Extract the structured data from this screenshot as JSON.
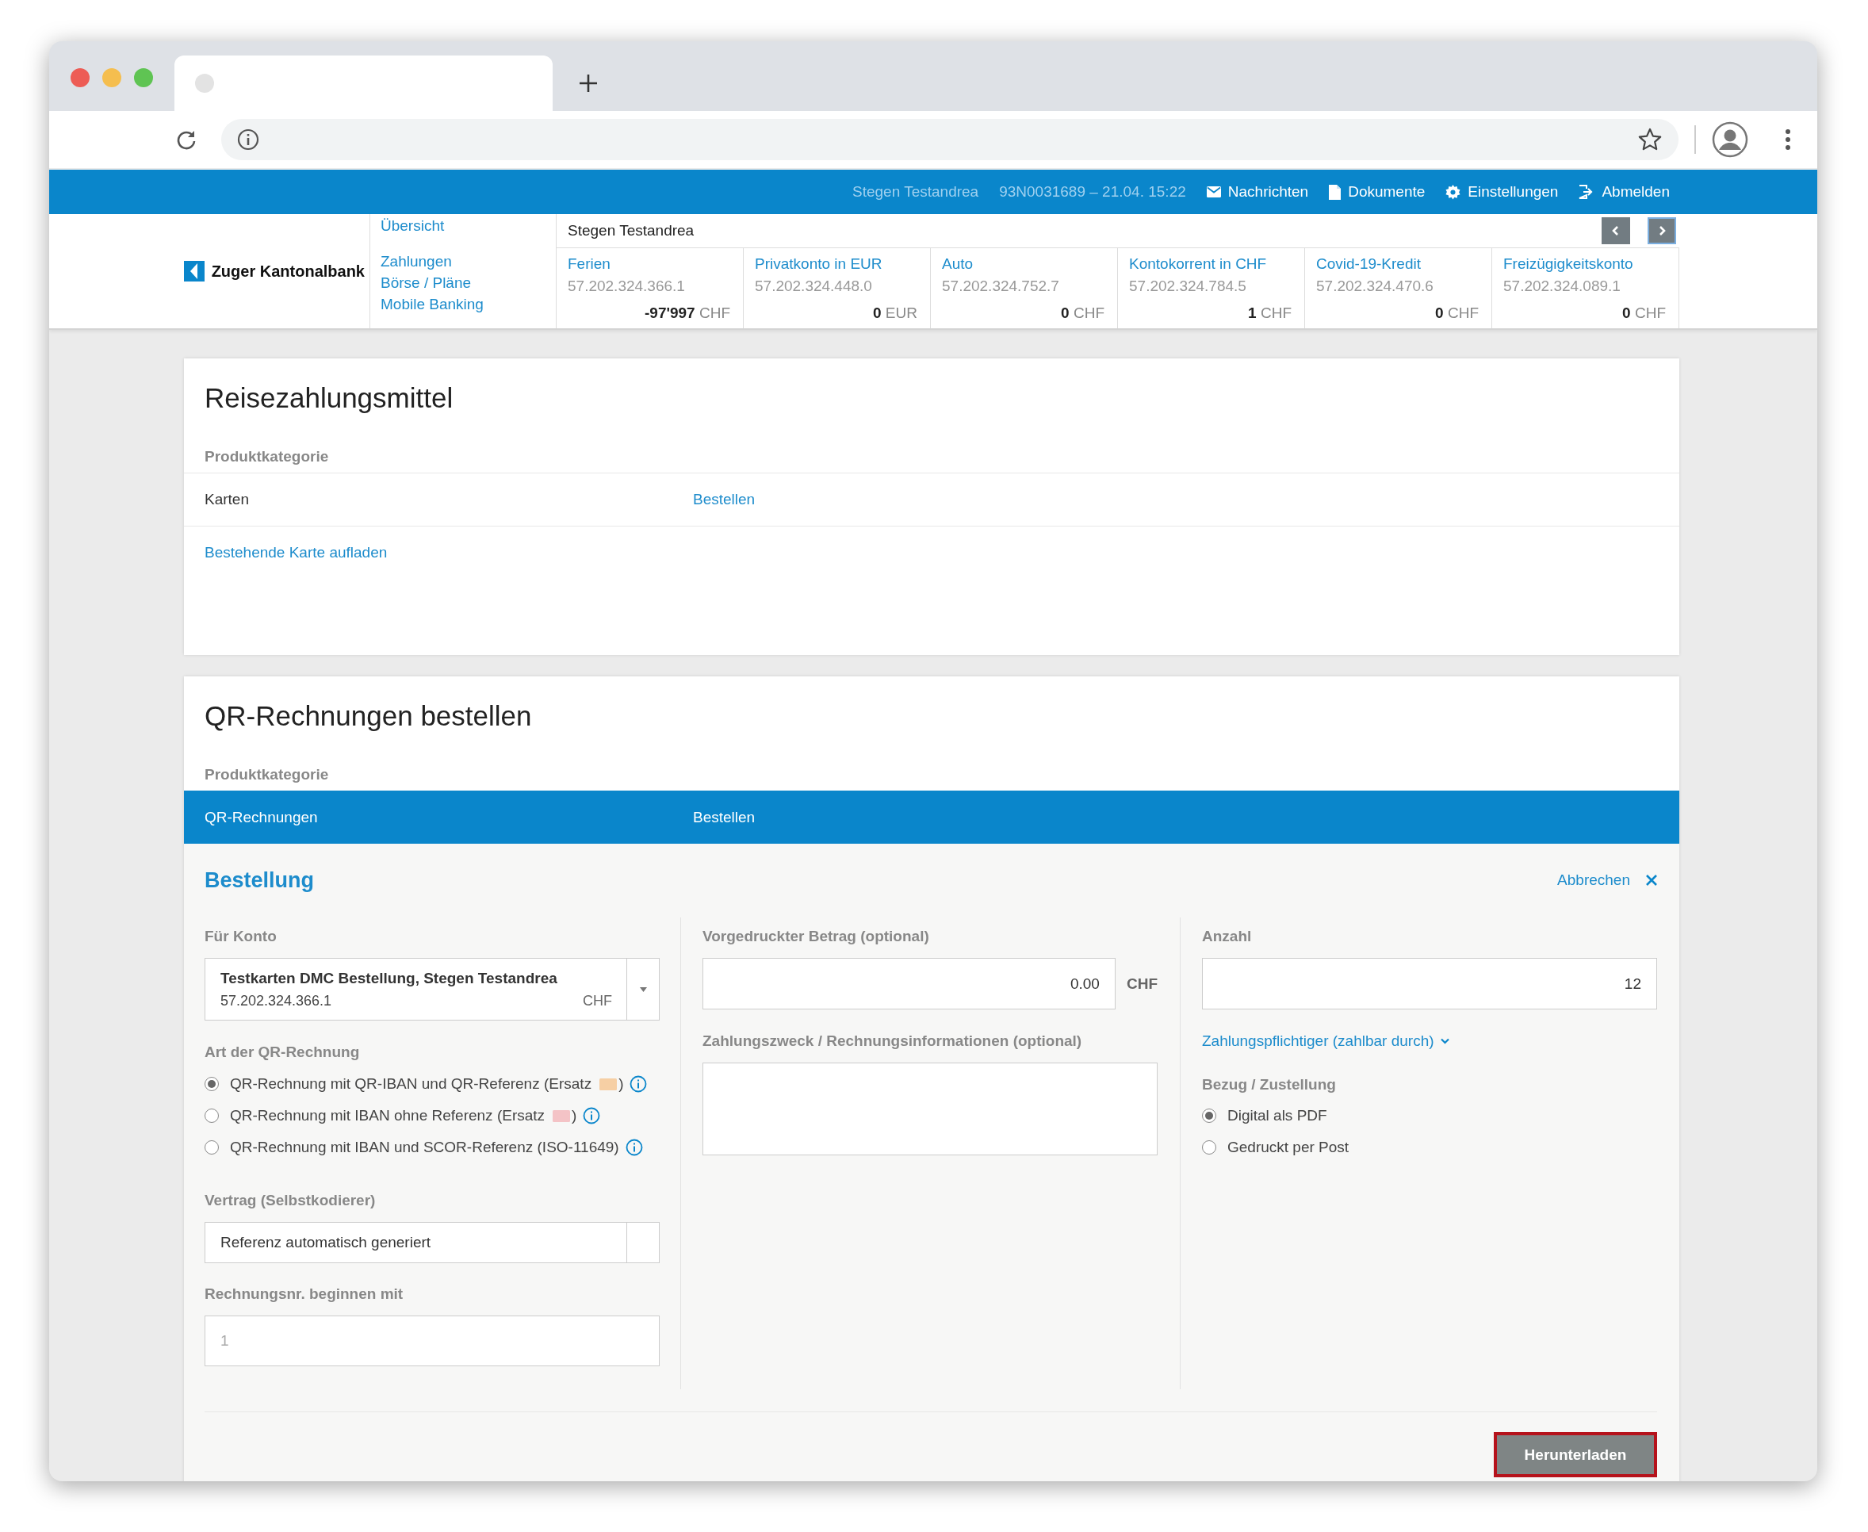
{
  "top_bar": {
    "user": "Stegen Testandrea",
    "session": "93N0031689 – 21.04. 15:22",
    "links": [
      {
        "kind": "messages",
        "label": "Nachrichten"
      },
      {
        "kind": "documents",
        "label": "Dokumente"
      },
      {
        "kind": "settings",
        "label": "Einstellungen"
      },
      {
        "kind": "logout",
        "label": "Abmelden"
      }
    ]
  },
  "brand": {
    "name": "Zuger Kantonalbank"
  },
  "nav": {
    "overview": "Übersicht",
    "items": [
      "Zahlungen",
      "Börse / Pläne",
      "Mobile Banking"
    ]
  },
  "accounts": {
    "owner": "Stegen Testandrea",
    "items": [
      {
        "name": "Ferien",
        "number": "57.202.324.366.1",
        "amount": "-97'997",
        "currency": "CHF"
      },
      {
        "name": "Privatkonto in EUR",
        "number": "57.202.324.448.0",
        "amount": "0",
        "currency": "EUR"
      },
      {
        "name": "Auto",
        "number": "57.202.324.752.7",
        "amount": "0",
        "currency": "CHF"
      },
      {
        "name": "Kontokorrent in CHF",
        "number": "57.202.324.784.5",
        "amount": "1",
        "currency": "CHF"
      },
      {
        "name": "Covid-19-Kredit",
        "number": "57.202.324.470.6",
        "amount": "0",
        "currency": "CHF"
      },
      {
        "name": "Freizügigkeitskonto",
        "number": "57.202.324.089.1",
        "amount": "0",
        "currency": "CHF"
      }
    ]
  },
  "sections": [
    {
      "title": "Reisezahlungsmittel",
      "column_label": "Produktkategorie",
      "rows": [
        {
          "kind": "category",
          "name": "Karten",
          "action": "Bestellen",
          "selected": false
        },
        {
          "kind": "link",
          "name": "Bestehende Karte aufladen",
          "selected": false
        }
      ]
    },
    {
      "title": "QR-Rechnungen bestellen",
      "column_label": "Produktkategorie",
      "rows": [
        {
          "kind": "category",
          "name": "QR-Rechnungen",
          "action": "Bestellen",
          "selected": true
        }
      ],
      "order": {
        "title": "Bestellung",
        "cancel": "Abbrechen",
        "account": {
          "label": "Für Konto",
          "name": "Testkarten DMC Bestellung, Stegen Testandrea",
          "number": "57.202.324.366.1",
          "currency": "CHF"
        },
        "qr_type": {
          "label": "Art der QR-Rechnung",
          "options": [
            {
              "label": "QR-Rechnung mit QR-IBAN und QR-Referenz (Ersatz",
              "suffix": ")",
              "color": "#f6cfa4",
              "selected": true
            },
            {
              "label": "QR-Rechnung mit IBAN ohne Referenz (Ersatz",
              "suffix": ")",
              "color": "#f4c3c6",
              "selected": false
            },
            {
              "label": "QR-Rechnung mit IBAN und SCOR-Referenz (ISO-11649)",
              "selected": false
            }
          ]
        },
        "contract": {
          "label": "Vertrag (Selbstkodierer)",
          "value": "Referenz automatisch generiert"
        },
        "invoice_start": {
          "label": "Rechnungsnr. beginnen mit",
          "placeholder": "1"
        },
        "amount": {
          "label": "Vorgedruckter Betrag (optional)",
          "value": "0.00",
          "currency": "CHF"
        },
        "purpose": {
          "label": "Zahlungszweck / Rechnungsinformationen (optional)"
        },
        "quantity": {
          "label": "Anzahl",
          "value": "12"
        },
        "payer_link": "Zahlungspflichtiger (zahlbar durch)",
        "delivery": {
          "label": "Bezug / Zustellung",
          "options": [
            {
              "label": "Digital als PDF",
              "selected": true
            },
            {
              "label": "Gedruckt per Post",
              "selected": false
            }
          ]
        },
        "submit": "Herunterladen"
      }
    }
  ]
}
